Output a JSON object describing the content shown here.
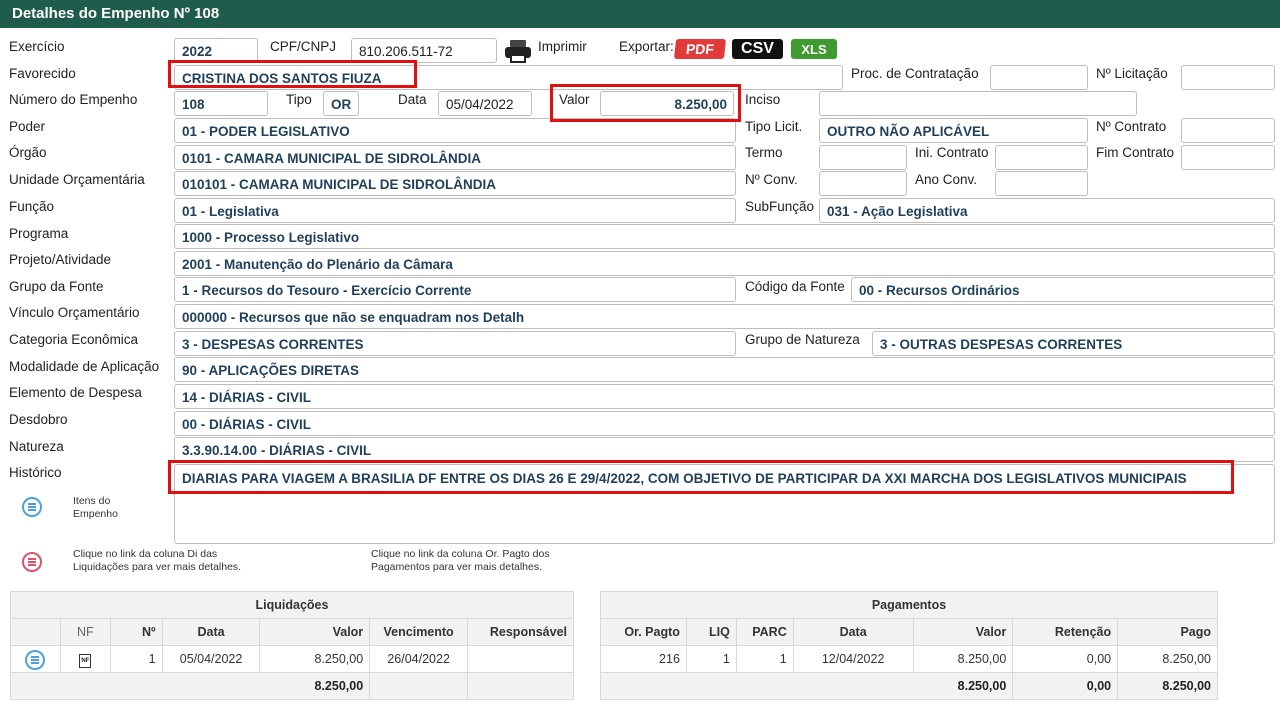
{
  "title": "Detalhes do Empenho Nº 108",
  "labels": {
    "exercicio": "Exercício",
    "cpf_cnpj": "CPF/CNPJ",
    "imprimir": "Imprimir",
    "exportar": "Exportar:",
    "favorecido": "Favorecido",
    "proc_contratacao": "Proc. de Contratação",
    "n_licitacao": "Nº Licitação",
    "numero_empenho": "Número do Empenho",
    "tipo": "Tipo",
    "data": "Data",
    "valor": "Valor",
    "inciso": "Inciso",
    "poder": "Poder",
    "tipo_licit": "Tipo Licit.",
    "n_contrato": "Nº Contrato",
    "orgao": "Órgão",
    "termo": "Termo",
    "ini_contrato": "Ini. Contrato",
    "fim_contrato": "Fim Contrato",
    "unidade_orcamentaria": "Unidade Orçamentária",
    "n_conv": "Nº Conv.",
    "ano_conv": "Ano Conv.",
    "funcao": "Função",
    "subfuncao": "SubFunção",
    "programa": "Programa",
    "projeto_atividade": "Projeto/Atividade",
    "grupo_fonte": "Grupo da Fonte",
    "codigo_fonte": "Código da Fonte",
    "vinculo_orcamentario": "Vínculo Orçamentário",
    "categoria_economica": "Categoria Econômica",
    "grupo_natureza": "Grupo de Natureza",
    "modalidade_aplicacao": "Modalidade de Aplicação",
    "elemento_despesa": "Elemento de Despesa",
    "desdobro": "Desdobro",
    "natureza": "Natureza",
    "historico": "Histórico",
    "itens_empenho": "Itens do Empenho"
  },
  "export": {
    "pdf": "PDF",
    "csv": "CSV",
    "xls": "XLS"
  },
  "values": {
    "exercicio": "2022",
    "cpf_cnpj": "810.206.511-72",
    "favorecido": "CRISTINA DOS SANTOS FIUZA",
    "proc_contratacao": "",
    "n_licitacao": "",
    "numero_empenho": "108",
    "tipo": "OR",
    "data": "05/04/2022",
    "valor": "8.250,00",
    "inciso": "",
    "poder": "01 - PODER LEGISLATIVO",
    "tipo_licit": "OUTRO NÃO APLICÁVEL",
    "n_contrato": "",
    "orgao": "0101 - CAMARA MUNICIPAL DE SIDROLÂNDIA",
    "termo": "",
    "ini_contrato": "",
    "fim_contrato": "",
    "unidade_orcamentaria": "010101 - CAMARA MUNICIPAL DE SIDROLÂNDIA",
    "n_conv": "",
    "ano_conv": "",
    "funcao": "01 - Legislativa",
    "subfuncao": "031 - Ação Legislativa",
    "programa": "1000 - Processo Legislativo",
    "projeto_atividade": "2001 - Manutenção do Plenário da Câmara",
    "grupo_fonte": "1 - Recursos do Tesouro - Exercício Corrente",
    "codigo_fonte": "00 - Recursos Ordinários",
    "vinculo_orcamentario": "000000 - Recursos que não se enquadram nos Detalh",
    "categoria_economica": "3 - DESPESAS CORRENTES",
    "grupo_natureza": "3 - OUTRAS DESPESAS CORRENTES",
    "modalidade_aplicacao": "90 - APLICAÇÕES DIRETAS",
    "elemento_despesa": "14 - DIÁRIAS - CIVIL",
    "desdobro": "00 - DIÁRIAS - CIVIL",
    "natureza": "3.3.90.14.00 - DIÁRIAS - CIVIL",
    "historico": "DIARIAS PARA VIAGEM A BRASILIA DF ENTRE OS DIAS 26 E 29/4/2022, COM OBJETIVO DE PARTICIPAR DA XXI MARCHA DOS LEGISLATIVOS MUNICIPAIS"
  },
  "notes": {
    "liquidacoes": "Clique no link da coluna Di das Liquidações para ver mais detalhes.",
    "pagamentos": "Clique no link da coluna Or. Pagto dos Pagamentos para ver mais detalhes."
  },
  "liquidacoes": {
    "caption": "Liquidações",
    "headers": [
      "",
      "NF",
      "Nº",
      "Data",
      "Valor",
      "Vencimento",
      "Responsável"
    ],
    "row": {
      "nf_icon": "NF",
      "numero": "1",
      "data": "05/04/2022",
      "valor": "8.250,00",
      "vencimento": "26/04/2022",
      "responsavel": ""
    },
    "total": "8.250,00"
  },
  "pagamentos": {
    "caption": "Pagamentos",
    "headers": [
      "Or. Pagto",
      "LIQ",
      "PARC",
      "Data",
      "Valor",
      "Retenção",
      "Pago"
    ],
    "row": {
      "or_pagto": "216",
      "liq": "1",
      "parc": "1",
      "data": "12/04/2022",
      "valor": "8.250,00",
      "retencao": "0,00",
      "pago": "8.250,00"
    },
    "totals": {
      "valor": "8.250,00",
      "retencao": "0,00",
      "pago": "8.250,00"
    }
  },
  "colors": {
    "header_bg": "#1f5c4b",
    "pdf": "#e03a3a",
    "csv": "#111111",
    "xls": "#3f9b2f",
    "highlight": "#e01010"
  }
}
